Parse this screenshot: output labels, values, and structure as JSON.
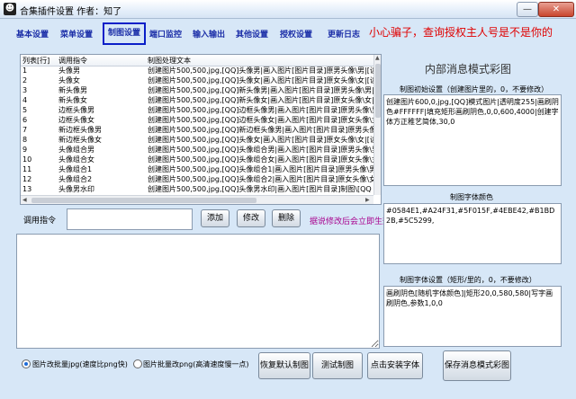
{
  "window": {
    "title": "合集插件设置  作者：知了",
    "minimize": "—",
    "close": "✕"
  },
  "tabs": [
    {
      "label": "基本设置"
    },
    {
      "label": "菜单设置"
    },
    {
      "label": "制图设置"
    },
    {
      "label": "端口监控"
    },
    {
      "label": "输入输出"
    },
    {
      "label": "其他设置"
    },
    {
      "label": "授权设置"
    },
    {
      "label": "更新日志"
    }
  ],
  "warning_text": "小心骗子，查询授权主人号是不是你的",
  "list": {
    "headers": [
      "列表[行]",
      "调用指令",
      "制图处理文本"
    ],
    "rows": [
      {
        "idx": "1",
        "cmd": "头像男",
        "text": "创建图片500,500,jpg,[QQ]头像男|画入图片[图片目录]原男头像\\男|[读"
      },
      {
        "idx": "2",
        "cmd": "头像女",
        "text": "创建图片500,500,jpg,[QQ]头像女|画入图片[图片目录]原女头像\\女|[读"
      },
      {
        "idx": "3",
        "cmd": "新头像男",
        "text": "创建图片500,500,jpg,[QQ]新头像男|画入图片[图片目录]原男头像\\男|"
      },
      {
        "idx": "4",
        "cmd": "新头像女",
        "text": "创建图片500,500,jpg,[QQ]新头像女|画入图片[图片目录]原女头像\\女|"
      },
      {
        "idx": "5",
        "cmd": "边框头像男",
        "text": "创建图片500,500,jpg,[QQ]边框头像男|画入图片[图片目录]原男头像\\男|"
      },
      {
        "idx": "6",
        "cmd": "边框头像女",
        "text": "创建图片500,500,jpg,[QQ]边框头像女|画入图片[图片目录]原女头像\\女|"
      },
      {
        "idx": "7",
        "cmd": "新边框头像男",
        "text": "创建图片500,500,jpg,[QQ]新边框头像男|画入图片[图片目录]原男头像\\男|"
      },
      {
        "idx": "8",
        "cmd": "新边框头像女",
        "text": "创建图片500,500,jpg,[QQ]头像女|画入图片[图片目录]原女头像\\女|[读"
      },
      {
        "idx": "9",
        "cmd": "头像组合男",
        "text": "创建图片500,500,jpg,[QQ]头像组合男|画入图片[图片目录]原男头像\\男|"
      },
      {
        "idx": "10",
        "cmd": "头像组合女",
        "text": "创建图片500,500,jpg,[QQ]头像组合女|画入图片[图片目录]原女头像\\女|"
      },
      {
        "idx": "11",
        "cmd": "头像组合1",
        "text": "创建图片500,500,jpg,[QQ]头像组合1|画入图片[图片目录]原男头像\\男|"
      },
      {
        "idx": "12",
        "cmd": "头像组合2",
        "text": "创建图片500,500,jpg,[QQ]头像组合2|画入图片[图片目录]原女头像\\女|"
      },
      {
        "idx": "13",
        "cmd": "头像男水印",
        "text": "创建图片500,500,jpg,[QQ]头像男水印|画入图片[图片目录]制图\\[QQ"
      }
    ]
  },
  "command": {
    "label": "调用指令",
    "value": "",
    "add": "添加",
    "modify": "修改",
    "delete": "删除",
    "hint": "据说修改后会立即生效"
  },
  "bottom": {
    "radio1": "图片改批量jpg(速度比png快)",
    "radio2": "图片批量改png(高清速度慢一点)",
    "restore": "恢复默认制图",
    "test": "测试制图",
    "install_font": "点击安装字体",
    "save": "保存消息模式彩图"
  },
  "panel": {
    "title": "内部消息模式彩图",
    "init_label": "制图初始设置（创建图片里的，0，不要修改）",
    "init_text": "创建图片600,0,jpg,[QQ]模式图片|透明度255|画刷阴色#FFFFFF|填充矩形画刷阴色,0,0,600,4000|创建字体方正稚艺简体,30,0",
    "color_label": "制图字体颜色",
    "color_text": "#0584E1,#A24F31,#5F015F,#4EBE42,#B1BD2B,#5C5299,",
    "rect_label": "制图字体设置（矩形/里的，0，不要修改）",
    "rect_text": "画刷阴色[随机字体颜色]|矩形20,0,580,580|写字画刷阴色,参数1,0,0"
  }
}
